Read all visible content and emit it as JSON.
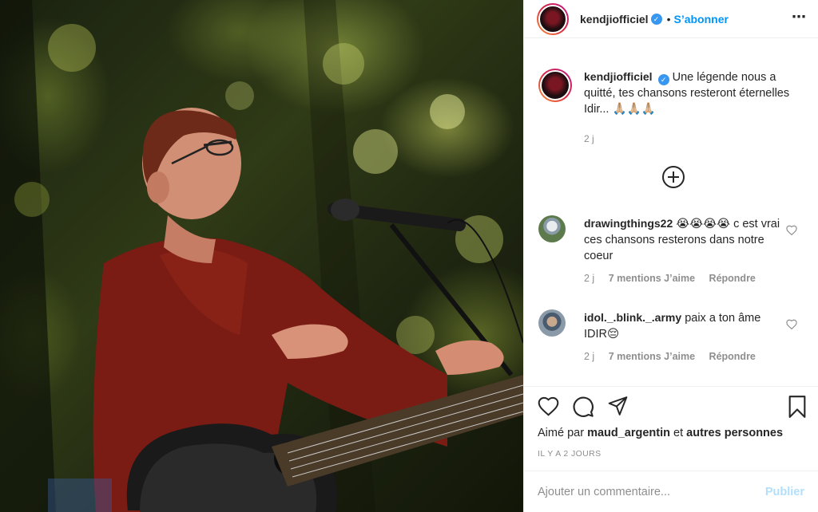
{
  "post": {
    "username": "kendjiofficiel",
    "verified_badge": "✓",
    "follow_label": "S’abonner",
    "more_icon": "⋯",
    "caption": "Une légende nous a quitté, tes chansons resteront éternelles Idir... 🙏🏼🙏🏼🙏🏼",
    "caption_time": "2 j"
  },
  "comments": [
    {
      "username": "drawingthings22",
      "text": "😭😭😭😭 c est vrai ces chansons resterons dans notre coeur",
      "time": "2 j",
      "likes": "7 mentions J’aime",
      "reply": "Répondre"
    },
    {
      "username": "idol._.blink._.army",
      "text": "paix a ton âme IDIR😔",
      "time": "2 j",
      "likes": "7 mentions J’aime",
      "reply": "Répondre"
    }
  ],
  "likes_line": {
    "prefix": "Aimé par",
    "user": "maud_argentin",
    "conj": "et",
    "others": "autres personnes"
  },
  "posted_ago": "IL Y A 2 JOURS",
  "composer": {
    "placeholder": "Ajouter un commentaire...",
    "publish_label": "Publier"
  },
  "icons": [
    "heart-icon",
    "comment-icon",
    "share-icon",
    "bookmark-icon",
    "plus-circle-icon",
    "more-icon"
  ],
  "colors": {
    "accent": "#0095f6",
    "publish_disabled": "#b2dffc",
    "muted": "#8e8e8e",
    "text": "#262626"
  }
}
